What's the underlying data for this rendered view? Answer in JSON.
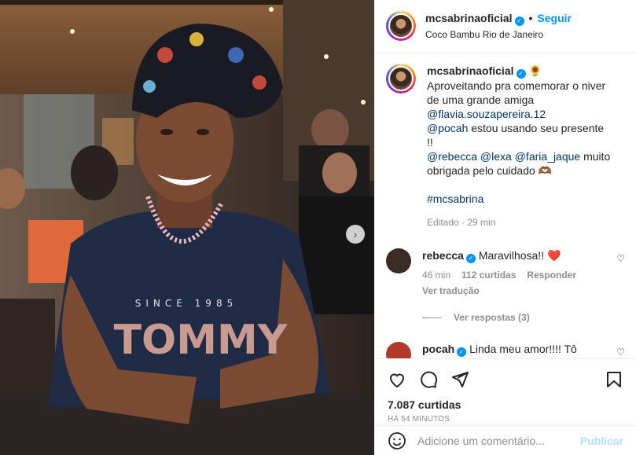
{
  "post": {
    "username": "mcsabrinaoficial",
    "follow_label": "Seguir",
    "dot": "•",
    "location": "Coco Bambu Rio de Janeiro"
  },
  "caption": {
    "username": "mcsabrinaoficial",
    "emoji": "🌻",
    "lines": [
      "Aproveitando pra comemorar o niver",
      "de uma grande amiga",
      "@flavia.souzapereira.12",
      "estou usando seu presente",
      "!!",
      "muito",
      "obrigada pelo cuidado 🫶🏾"
    ],
    "mention_pocah": "@pocah",
    "mention_rebecca": "@rebecca",
    "mention_lexa": "@lexa",
    "mention_faria": "@faria_jaque",
    "hashtag": "#mcsabrina",
    "edited": "Editado · 29 min"
  },
  "comments": [
    {
      "username": "rebecca",
      "text": "Maravilhosa!! ❤️",
      "time": "46 min",
      "likes": "112 curtidas",
      "reply": "Responder",
      "translate": "Ver tradução",
      "avatar_color": "#3b2b25"
    },
    {
      "username": "pocah",
      "text": "Linda meu amor!!!! Tô",
      "avatar_color": "#b23a2b"
    }
  ],
  "view_replies": "Ver respostas (3)",
  "likes": "7.087 curtidas",
  "time_ago": "HÁ 54 MINUTOS",
  "add_comment": {
    "placeholder": "Adicione um comentário...",
    "publish": "Publicar"
  },
  "icons": {
    "heart": "heart-icon",
    "comment": "comment-icon",
    "share": "share-icon",
    "save": "bookmark-icon",
    "emoji": "emoji-icon",
    "next": "chevron-right-icon"
  }
}
